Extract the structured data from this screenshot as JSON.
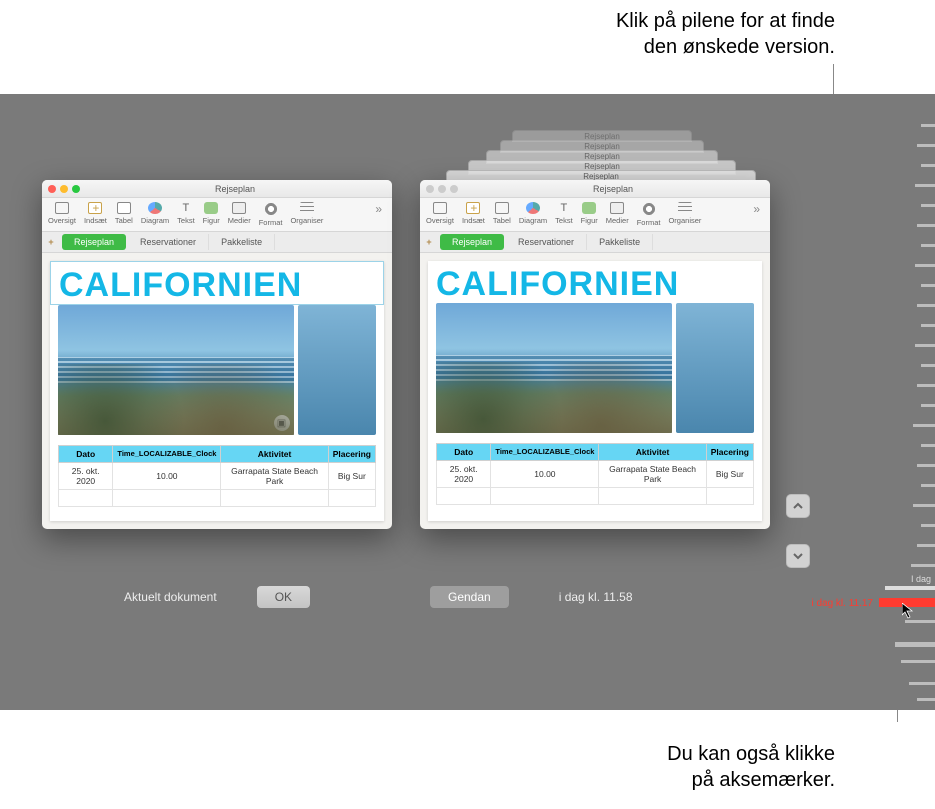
{
  "callouts": {
    "top": "Klik på pilene for at finde\nden ønskede version.",
    "bottom": "Du kan også klikke\npå aksemærker."
  },
  "ghost_title": "Rejseplan",
  "window": {
    "title": "Rejseplan",
    "toolbar": [
      {
        "key": "overview",
        "label": "Oversigt"
      },
      {
        "key": "insert",
        "label": "Indsæt"
      },
      {
        "key": "table",
        "label": "Tabel"
      },
      {
        "key": "chart",
        "label": "Diagram"
      },
      {
        "key": "text",
        "label": "Tekst"
      },
      {
        "key": "shape",
        "label": "Figur"
      },
      {
        "key": "media",
        "label": "Medier"
      },
      {
        "key": "format",
        "label": "Format"
      },
      {
        "key": "organize",
        "label": "Organiser"
      }
    ],
    "more_glyph": "»",
    "tabs": {
      "add_glyph": "+",
      "items": [
        {
          "label": "Rejseplan",
          "active": true
        },
        {
          "label": "Reservationer",
          "active": false
        },
        {
          "label": "Pakkeliste",
          "active": false
        }
      ]
    },
    "headline": "CALIFORNIEN",
    "image_badge_icon": "image-icon",
    "table": {
      "headers": [
        "Dato",
        "Time_LOCALIZABLE_Clock",
        "Aktivitet",
        "Placering"
      ],
      "rows": [
        [
          "25. okt. 2020",
          "10.00",
          "Garrapata State Beach Park",
          "Big Sur"
        ]
      ]
    }
  },
  "actions": {
    "current_label": "Aktuelt dokument",
    "ok_label": "OK",
    "restore_label": "Gendan",
    "version_time": "i dag kl. 11.58"
  },
  "timeline": {
    "today_label": "I dag",
    "selected_label": "i dag kl. 11.17"
  }
}
